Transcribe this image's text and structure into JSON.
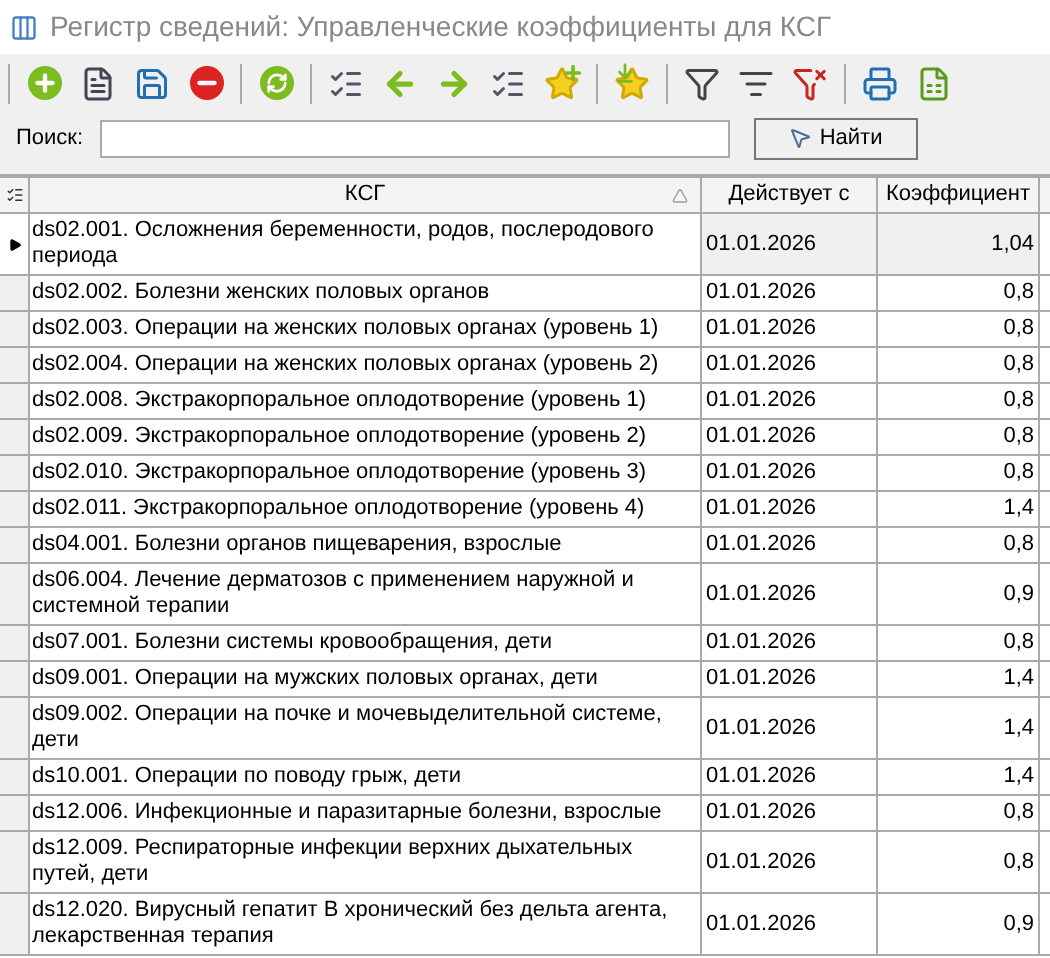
{
  "window": {
    "title": "Регистр сведений: Управленческие коэффициенты для КСГ"
  },
  "search": {
    "label": "Поиск:",
    "button": "Найти"
  },
  "table": {
    "columns": [
      "КСГ",
      "Действует с",
      "Коэффициент"
    ],
    "rows": [
      {
        "ksg": "ds02.001. Осложнения беременности, родов, послеродового периода",
        "date": "01.01.2026",
        "coef": "1,04",
        "selected": true
      },
      {
        "ksg": "ds02.002. Болезни женских половых органов",
        "date": "01.01.2026",
        "coef": "0,8",
        "selected": false
      },
      {
        "ksg": "ds02.003. Операции на женских половых органах (уровень 1)",
        "date": "01.01.2026",
        "coef": "0,8",
        "selected": false
      },
      {
        "ksg": "ds02.004. Операции на женских половых органах (уровень 2)",
        "date": "01.01.2026",
        "coef": "0,8",
        "selected": false
      },
      {
        "ksg": "ds02.008. Экстракорпоральное оплодотворение (уровень 1)",
        "date": "01.01.2026",
        "coef": "0,8",
        "selected": false
      },
      {
        "ksg": "ds02.009. Экстракорпоральное оплодотворение (уровень 2)",
        "date": "01.01.2026",
        "coef": "0,8",
        "selected": false
      },
      {
        "ksg": "ds02.010. Экстракорпоральное оплодотворение (уровень 3)",
        "date": "01.01.2026",
        "coef": "0,8",
        "selected": false
      },
      {
        "ksg": "ds02.011. Экстракорпоральное оплодотворение (уровень 4)",
        "date": "01.01.2026",
        "coef": "1,4",
        "selected": false
      },
      {
        "ksg": "ds04.001. Болезни органов пищеварения, взрослые",
        "date": "01.01.2026",
        "coef": "0,8",
        "selected": false
      },
      {
        "ksg": "ds06.004. Лечение дерматозов с применением наружной и системной терапии",
        "date": "01.01.2026",
        "coef": "0,9",
        "selected": false
      },
      {
        "ksg": "ds07.001. Болезни системы кровообращения, дети",
        "date": "01.01.2026",
        "coef": "0,8",
        "selected": false
      },
      {
        "ksg": "ds09.001. Операции на мужских половых органах, дети",
        "date": "01.01.2026",
        "coef": "1,4",
        "selected": false
      },
      {
        "ksg": "ds09.002. Операции на почке и мочевыделительной системе, дети",
        "date": "01.01.2026",
        "coef": "1,4",
        "selected": false
      },
      {
        "ksg": "ds10.001. Операции по поводу грыж, дети",
        "date": "01.01.2026",
        "coef": "1,4",
        "selected": false
      },
      {
        "ksg": "ds12.006. Инфекционные и паразитарные болезни, взрослые",
        "date": "01.01.2026",
        "coef": "0,8",
        "selected": false
      },
      {
        "ksg": "ds12.009. Респираторные инфекции верхних дыхательных путей, дети",
        "date": "01.01.2026",
        "coef": "0,8",
        "selected": false
      },
      {
        "ksg": "ds12.020. Вирусный гепатит B хронический без дельта агента, лекарственная терапия",
        "date": "01.01.2026",
        "coef": "0,9",
        "selected": false
      }
    ]
  }
}
